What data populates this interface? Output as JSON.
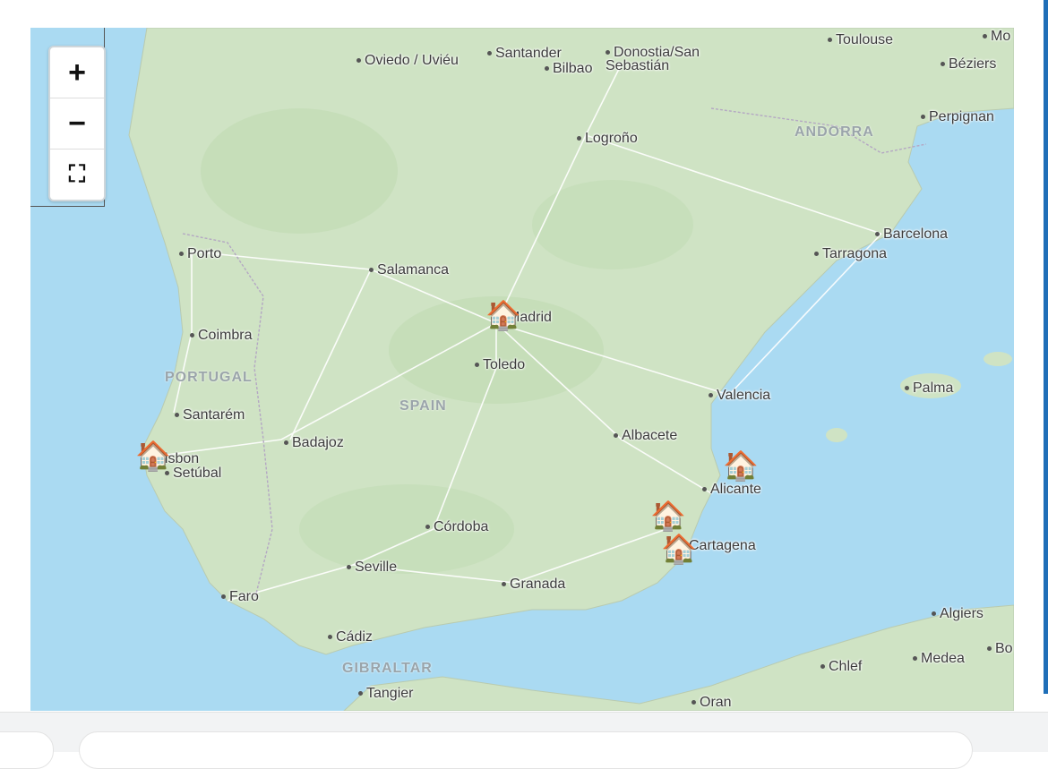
{
  "map": {
    "controls": {
      "zoom_in": "+",
      "zoom_out": "−",
      "fullscreen": "⛶"
    },
    "countries": [
      "PORTUGAL",
      "SPAIN",
      "ANDORRA",
      "GIBRALTAR"
    ],
    "cities": [
      "Oviedo / Uviéu",
      "Santander",
      "Bilbao",
      "Donostia/San Sebastián",
      "Toulouse",
      "Mo",
      "Béziers",
      "Perpignan",
      "Logroño",
      "Barcelona",
      "Tarragona",
      "Porto",
      "Salamanca",
      "Madrid",
      "Coimbra",
      "Toledo",
      "Santarém",
      "Badajoz",
      "Lisbon",
      "Setúbal",
      "Valencia",
      "Palma",
      "Albacete",
      "Alicante",
      "Cartagena",
      "Córdoba",
      "Seville",
      "Granada",
      "Faro",
      "Cádiz",
      "Tangier",
      "Oran",
      "Chlef",
      "Medea",
      "Algiers",
      "Bo"
    ],
    "markers": [
      {
        "icon": "house-icon",
        "glyph": "🏠",
        "near": "Madrid"
      },
      {
        "icon": "house-icon",
        "glyph": "🏠",
        "near": "Lisbon"
      },
      {
        "icon": "house-icon",
        "glyph": "🏠",
        "near": "Alicante"
      },
      {
        "icon": "house-icon",
        "glyph": "🏠",
        "near": "Cartagena"
      },
      {
        "icon": "house-icon",
        "glyph": "🏠",
        "near": "Cartagena"
      }
    ],
    "colors": {
      "water": "#aadaf2",
      "land": "#cfe3c4",
      "accent": "#1f6fb8"
    }
  }
}
